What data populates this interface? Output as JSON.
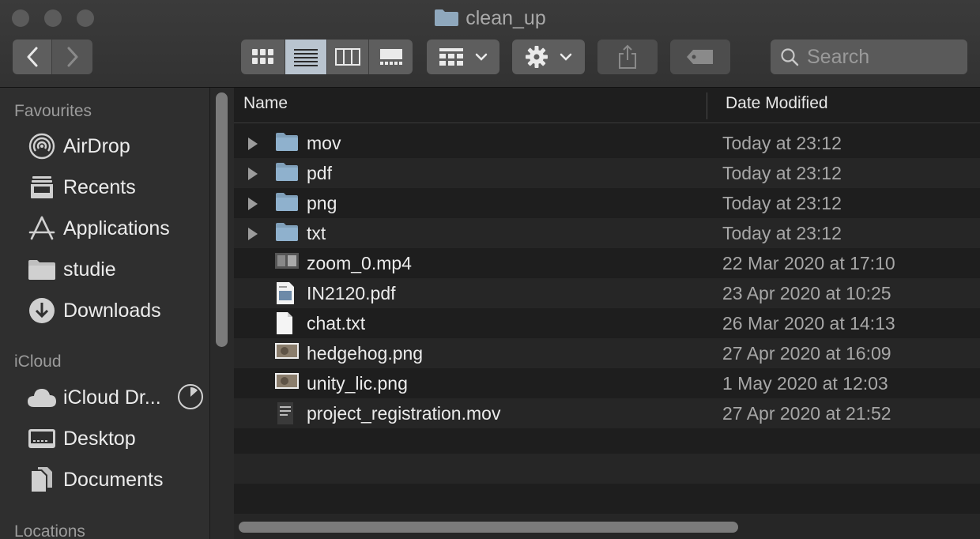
{
  "window": {
    "title": "clean_up",
    "traffic_lights": [
      "close",
      "minimize",
      "zoom"
    ]
  },
  "toolbar": {
    "back_icon": "chevron-left-icon",
    "forward_icon": "chevron-right-icon",
    "view_modes": [
      {
        "name": "icon-view",
        "active": false
      },
      {
        "name": "list-view",
        "active": true
      },
      {
        "name": "column-view",
        "active": false
      },
      {
        "name": "gallery-view",
        "active": false
      }
    ],
    "group_icon": "group-grid-icon",
    "action_icon": "gear-icon",
    "share_icon": "share-icon",
    "tag_icon": "tag-icon",
    "search": {
      "placeholder": "Search",
      "value": ""
    }
  },
  "sidebar": {
    "sections": [
      {
        "title": "Favourites",
        "items": [
          {
            "label": "AirDrop",
            "icon": "airdrop-icon"
          },
          {
            "label": "Recents",
            "icon": "recents-icon"
          },
          {
            "label": "Applications",
            "icon": "applications-icon"
          },
          {
            "label": "studie",
            "icon": "folder-icon"
          },
          {
            "label": "Downloads",
            "icon": "downloads-icon"
          }
        ]
      },
      {
        "title": "iCloud",
        "items": [
          {
            "label": "iCloud Dr...",
            "icon": "cloud-icon"
          },
          {
            "label": "Desktop",
            "icon": "desktop-icon"
          },
          {
            "label": "Documents",
            "icon": "documents-icon"
          }
        ]
      },
      {
        "title": "Locations",
        "items": []
      }
    ]
  },
  "file_list": {
    "columns": [
      "Name",
      "Date Modified"
    ],
    "rows": [
      {
        "name": "mov",
        "date": "Today at 23:12",
        "kind": "folder"
      },
      {
        "name": "pdf",
        "date": "Today at 23:12",
        "kind": "folder"
      },
      {
        "name": "png",
        "date": "Today at 23:12",
        "kind": "folder"
      },
      {
        "name": "txt",
        "date": "Today at 23:12",
        "kind": "folder"
      },
      {
        "name": "zoom_0.mp4",
        "date": "22 Mar 2020 at 17:10",
        "kind": "video"
      },
      {
        "name": "IN2120.pdf",
        "date": "23 Apr 2020 at 10:25",
        "kind": "pdf"
      },
      {
        "name": "chat.txt",
        "date": "26 Mar 2020 at 14:13",
        "kind": "text"
      },
      {
        "name": "hedgehog.png",
        "date": "27 Apr 2020 at 16:09",
        "kind": "image"
      },
      {
        "name": "unity_lic.png",
        "date": "1 May 2020 at 12:03",
        "kind": "image"
      },
      {
        "name": "project_registration.mov",
        "date": "27 Apr 2020 at 21:52",
        "kind": "movie"
      }
    ]
  },
  "colors": {
    "window_bg": "#1e1e1e",
    "toolbar_bg": "#383838",
    "sidebar_bg": "#2f2f2f",
    "folder_blue": "#8fb1cd",
    "active_segment": "#b9c4cf"
  }
}
